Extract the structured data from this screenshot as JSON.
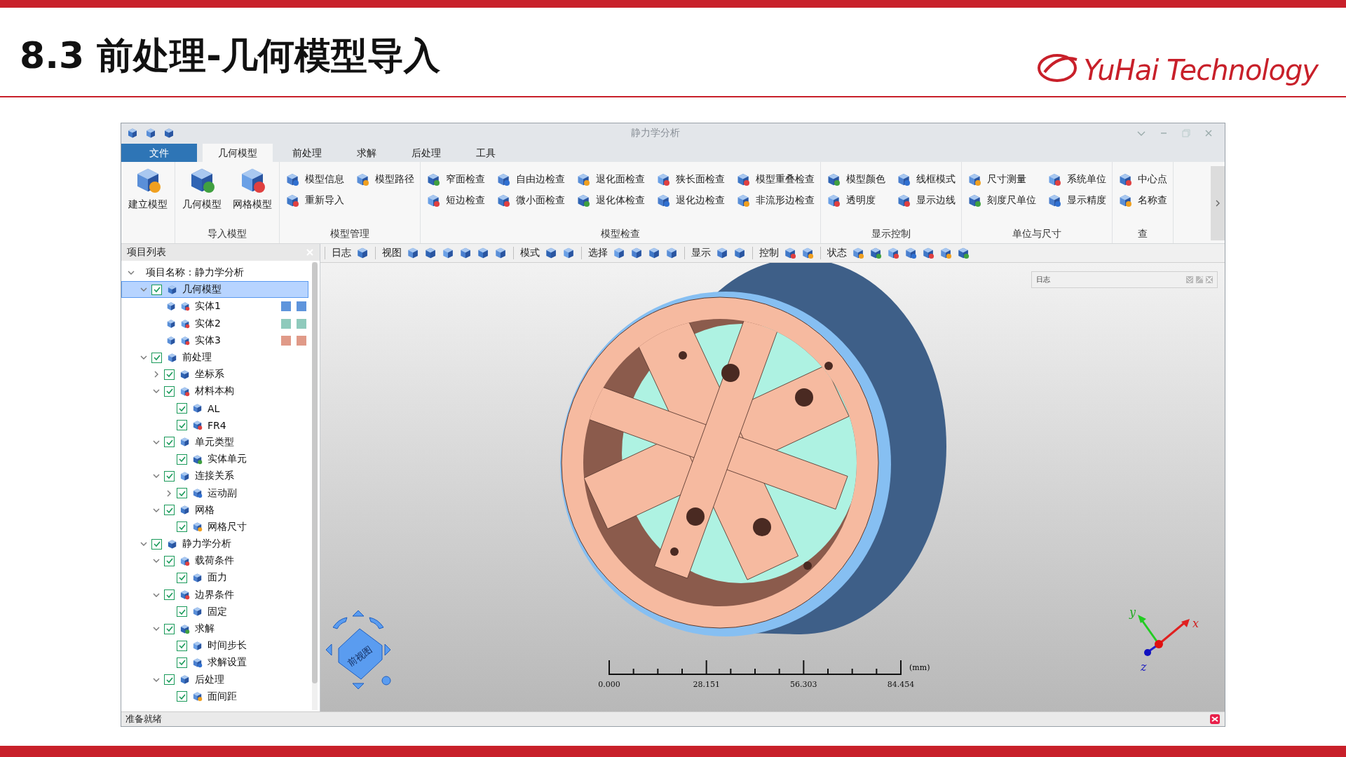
{
  "slide": {
    "title": "8.3 前处理-几何模型导入",
    "logo": "YuHai Technology"
  },
  "window": {
    "title": "静力学分析"
  },
  "tabs": [
    {
      "label": "文件",
      "kind": "file",
      "selected": false
    },
    {
      "label": "几何模型",
      "kind": "tab",
      "selected": true
    },
    {
      "label": "前处理",
      "kind": "tab",
      "selected": false
    },
    {
      "label": "求解",
      "kind": "tab",
      "selected": false
    },
    {
      "label": "后处理",
      "kind": "tab",
      "selected": false
    },
    {
      "label": "工具",
      "kind": "tab",
      "selected": false
    }
  ],
  "ribbon": {
    "groups": [
      {
        "items": [
          {
            "label": "建立模型",
            "kind": "large"
          }
        ]
      },
      {
        "label": "导入模型",
        "items": [
          {
            "label": "几何模型",
            "kind": "large"
          },
          {
            "label": "网格模型",
            "kind": "large"
          }
        ]
      },
      {
        "label": "模型管理",
        "items": [
          {
            "label": "模型信息",
            "kind": "small"
          },
          {
            "label": "重新导入",
            "kind": "small"
          },
          {
            "label": "模型路径",
            "kind": "small"
          }
        ]
      },
      {
        "label": "模型检查",
        "items": [
          {
            "label": "窄面检查",
            "kind": "small"
          },
          {
            "label": "短边检查",
            "kind": "small"
          },
          {
            "label": "自由边检查",
            "kind": "small"
          },
          {
            "label": "微小面检查",
            "kind": "small"
          },
          {
            "label": "退化面检查",
            "kind": "small"
          },
          {
            "label": "退化体检查",
            "kind": "small"
          },
          {
            "label": "狭长面检查",
            "kind": "small"
          },
          {
            "label": "退化边检查",
            "kind": "small"
          },
          {
            "label": "模型重叠检查",
            "kind": "small"
          },
          {
            "label": "非流形边检查",
            "kind": "small"
          }
        ]
      },
      {
        "label": "显示控制",
        "items": [
          {
            "label": "模型颜色",
            "kind": "small"
          },
          {
            "label": "透明度",
            "kind": "small"
          },
          {
            "label": "线框模式",
            "kind": "small"
          },
          {
            "label": "显示边线",
            "kind": "small"
          }
        ]
      },
      {
        "label": "单位与尺寸",
        "items": [
          {
            "label": "尺寸测量",
            "kind": "small"
          },
          {
            "label": "刻度尺单位",
            "kind": "small"
          },
          {
            "label": "系统单位",
            "kind": "small"
          },
          {
            "label": "显示精度",
            "kind": "small"
          }
        ]
      },
      {
        "label": "查",
        "items": [
          {
            "label": "中心点",
            "kind": "small"
          },
          {
            "label": "名称查",
            "kind": "small"
          }
        ]
      }
    ]
  },
  "panel": {
    "title": "项目列表"
  },
  "tree": {
    "label": "项目名称：静力学分析",
    "expanded": true,
    "selected": false,
    "children": [
      {
        "label": "几何模型",
        "checked": true,
        "expanded": true,
        "selected": true,
        "children": [
          {
            "label": "实体1",
            "kind": "entity",
            "color": "#5f95dc",
            "selected": false
          },
          {
            "label": "实体2",
            "kind": "entity",
            "color": "#8fcabc",
            "selected": false
          },
          {
            "label": "实体3",
            "kind": "entity",
            "color": "#e09a88",
            "selected": false
          }
        ]
      },
      {
        "label": "前处理",
        "checked": true,
        "expanded": true,
        "selected": false,
        "children": [
          {
            "label": "坐标系",
            "checked": true,
            "expanded": false,
            "selected": false
          },
          {
            "label": "材料本构",
            "checked": true,
            "expanded": true,
            "selected": false,
            "children": [
              {
                "label": "AL",
                "checked": true,
                "selected": false
              },
              {
                "label": "FR4",
                "checked": true,
                "selected": false
              }
            ]
          },
          {
            "label": "单元类型",
            "checked": true,
            "expanded": true,
            "selected": false,
            "children": [
              {
                "label": "实体单元",
                "checked": true,
                "selected": false
              }
            ]
          },
          {
            "label": "连接关系",
            "checked": true,
            "expanded": true,
            "selected": false,
            "children": [
              {
                "label": "运动副",
                "checked": true,
                "expanded": false,
                "selected": false
              }
            ]
          },
          {
            "label": "网格",
            "checked": true,
            "expanded": true,
            "selected": false,
            "children": [
              {
                "label": "网格尺寸",
                "checked": true,
                "selected": false
              }
            ]
          }
        ]
      },
      {
        "label": "静力学分析",
        "checked": true,
        "expanded": true,
        "selected": false,
        "children": [
          {
            "label": "载荷条件",
            "checked": true,
            "expanded": true,
            "selected": false,
            "children": [
              {
                "label": "面力",
                "checked": true,
                "selected": false
              }
            ]
          },
          {
            "label": "边界条件",
            "checked": true,
            "expanded": true,
            "selected": false,
            "children": [
              {
                "label": "固定",
                "checked": true,
                "selected": false
              }
            ]
          },
          {
            "label": "求解",
            "checked": true,
            "expanded": true,
            "selected": false,
            "children": [
              {
                "label": "时间步长",
                "checked": true,
                "selected": false
              },
              {
                "label": "求解设置",
                "checked": true,
                "selected": false
              }
            ]
          },
          {
            "label": "后处理",
            "checked": true,
            "expanded": true,
            "selected": false,
            "children": [
              {
                "label": "面间距",
                "checked": true,
                "selected": false
              }
            ]
          }
        ]
      }
    ]
  },
  "view_toolbar": [
    {
      "label": "日志"
    },
    {
      "label": "视图"
    },
    {
      "label": "模式"
    },
    {
      "label": "选择"
    },
    {
      "label": "显示"
    },
    {
      "label": "控制"
    },
    {
      "label": "状态"
    }
  ],
  "log_panel": {
    "title": "日志"
  },
  "nav_cube": {
    "label": "前视图"
  },
  "scale_bar": {
    "labels": [
      "0.000",
      "28.151",
      "56.303",
      "84.454"
    ],
    "unit": "(mm)"
  },
  "axes": {
    "x": "x",
    "y": "y",
    "z": "z"
  },
  "status_bar": {
    "text": "准备就绪"
  }
}
